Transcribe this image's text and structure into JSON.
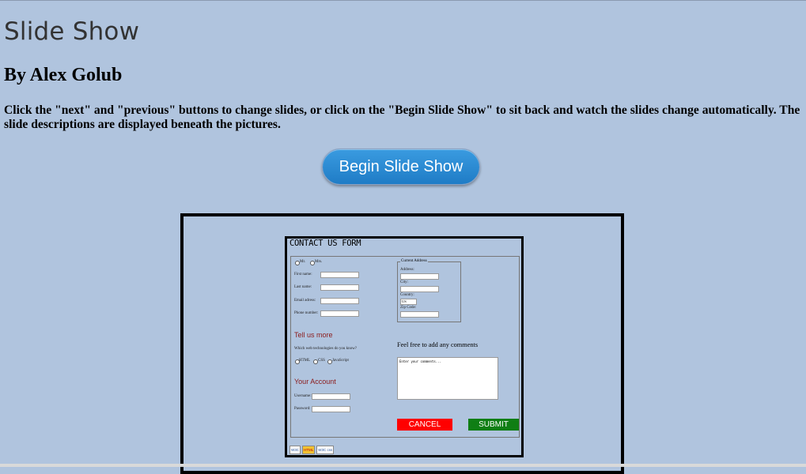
{
  "header": {
    "title": "Slide Show",
    "byline": "By Alex Golub",
    "intro": "Click the \"next\" and \"previous\" buttons to change slides, or click on the \"Begin Slide Show\" to sit back and watch the slides change automatically. The slide descriptions are displayed beneath the pictures."
  },
  "controls": {
    "begin_label": "Begin Slide Show"
  },
  "slide": {
    "form_title": "CONTACT US FORM",
    "title_options": [
      "Mr.",
      "Mrs."
    ],
    "personal_fields": [
      "First name:",
      "Last name:",
      "Email adress:",
      "Phone number:"
    ],
    "address_legend": "Current Address",
    "address_fields": [
      "Address:",
      "City:",
      "Country:",
      "Zip Code:"
    ],
    "country_value": "US",
    "tell_us_more": "Tell us more",
    "tech_question": "Which web technologies do you know?",
    "tech_options": [
      "HTML",
      "CSS",
      "JavaScript"
    ],
    "comments_label": "Feel free to add any comments",
    "comments_placeholder": "Enter your comments...",
    "your_account": "Your Account",
    "account_fields": [
      "Username:",
      "Password:"
    ],
    "cancel_label": "CANCEL",
    "submit_label": "SUBMIT",
    "badges": [
      "W3C",
      "HTML",
      "W3C css"
    ]
  },
  "colors": {
    "page_background": "#b0c4de",
    "button_blue": "#2a8bd6",
    "cancel_red": "#ff0000",
    "submit_green": "#0f7e14",
    "section_heading": "#8b1a1a"
  }
}
